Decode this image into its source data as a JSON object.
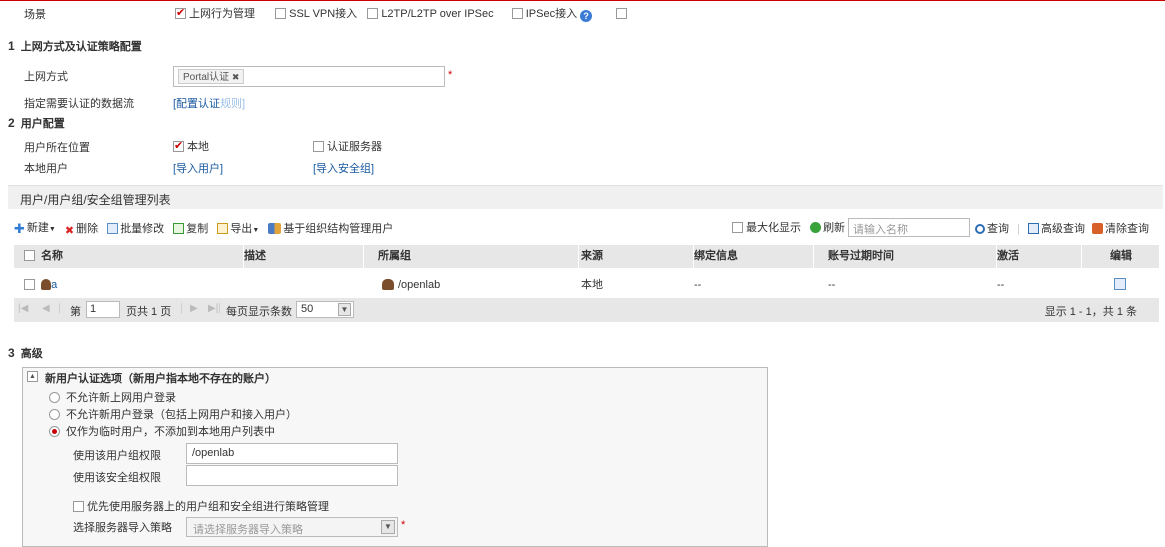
{
  "scene": {
    "label": "场景",
    "options": [
      {
        "label": "上网行为管理",
        "checked": true
      },
      {
        "label": "SSL VPN接入",
        "checked": false
      },
      {
        "label": "L2TP/L2TP over IPSec",
        "checked": false
      },
      {
        "label": "IPSec接入",
        "checked": false
      }
    ]
  },
  "section1": {
    "number": "1",
    "title": "上网方式及认证策略配置",
    "access_label": "上网方式",
    "access_tag": "Portal认证",
    "access_tag_remove": "✖",
    "required": "*",
    "flow_label": "指定需要认证的数据流",
    "flow_link": "[配置认证",
    "flow_link_faded": "规则]"
  },
  "section2": {
    "number": "2",
    "title": "用户配置",
    "location_label": "用户所在位置",
    "location_local": "本地",
    "location_server": "认证服务器",
    "local_user_label": "本地用户",
    "import_user": "[导入用户]",
    "import_group": "[导入安全组]"
  },
  "list": {
    "title": "用户/用户组/安全组管理列表",
    "toolbar": {
      "new": "新建",
      "delete": "删除",
      "batch_edit": "批量修改",
      "copy": "复制",
      "export": "导出",
      "org_manage": "基于组织结构管理用户",
      "maximize": "最大化显示",
      "refresh": "刷新",
      "search_placeholder": "请输入名称",
      "query": "查询",
      "advanced_query": "高级查询",
      "clear_query": "清除查询"
    },
    "columns": [
      "名称",
      "描述",
      "所属组",
      "来源",
      "绑定信息",
      "账号过期时间",
      "激活",
      "编辑"
    ],
    "rows": [
      {
        "name": "a",
        "desc": "",
        "group": "/openlab",
        "source": "本地",
        "bind": "--",
        "expire": "--",
        "active": "--"
      }
    ],
    "pager": {
      "page_prefix": "第",
      "page": "1",
      "total_pages": "页共 1 页",
      "per_page_label": "每页显示条数",
      "per_page": "50",
      "summary": "显示 1 - 1，共 1 条"
    }
  },
  "section3": {
    "number": "3",
    "title": "高级",
    "panel_title": "新用户认证选项（新用户指本地不存在的账户）",
    "collapse": "▲",
    "options": [
      {
        "label": "不允许新上网用户登录",
        "selected": false
      },
      {
        "label": "不允许新用户登录（包括上网用户和接入用户）",
        "selected": false
      },
      {
        "label": "仅作为临时用户，不添加到本地用户列表中",
        "selected": true
      }
    ],
    "group_perm_label": "使用该用户组权限",
    "group_perm_value": "/openlab",
    "secgroup_perm_label": "使用该安全组权限",
    "secgroup_perm_value": "",
    "prefer_server_label": "优先使用服务器上的用户组和安全组进行策略管理",
    "import_policy_label": "选择服务器导入策略",
    "import_policy_placeholder": "请选择服务器导入策略",
    "required": "*"
  },
  "colors": {
    "accent_red": "#cc0000",
    "link_blue": "#1a5aa0",
    "header_gray": "#e7e7e7"
  }
}
